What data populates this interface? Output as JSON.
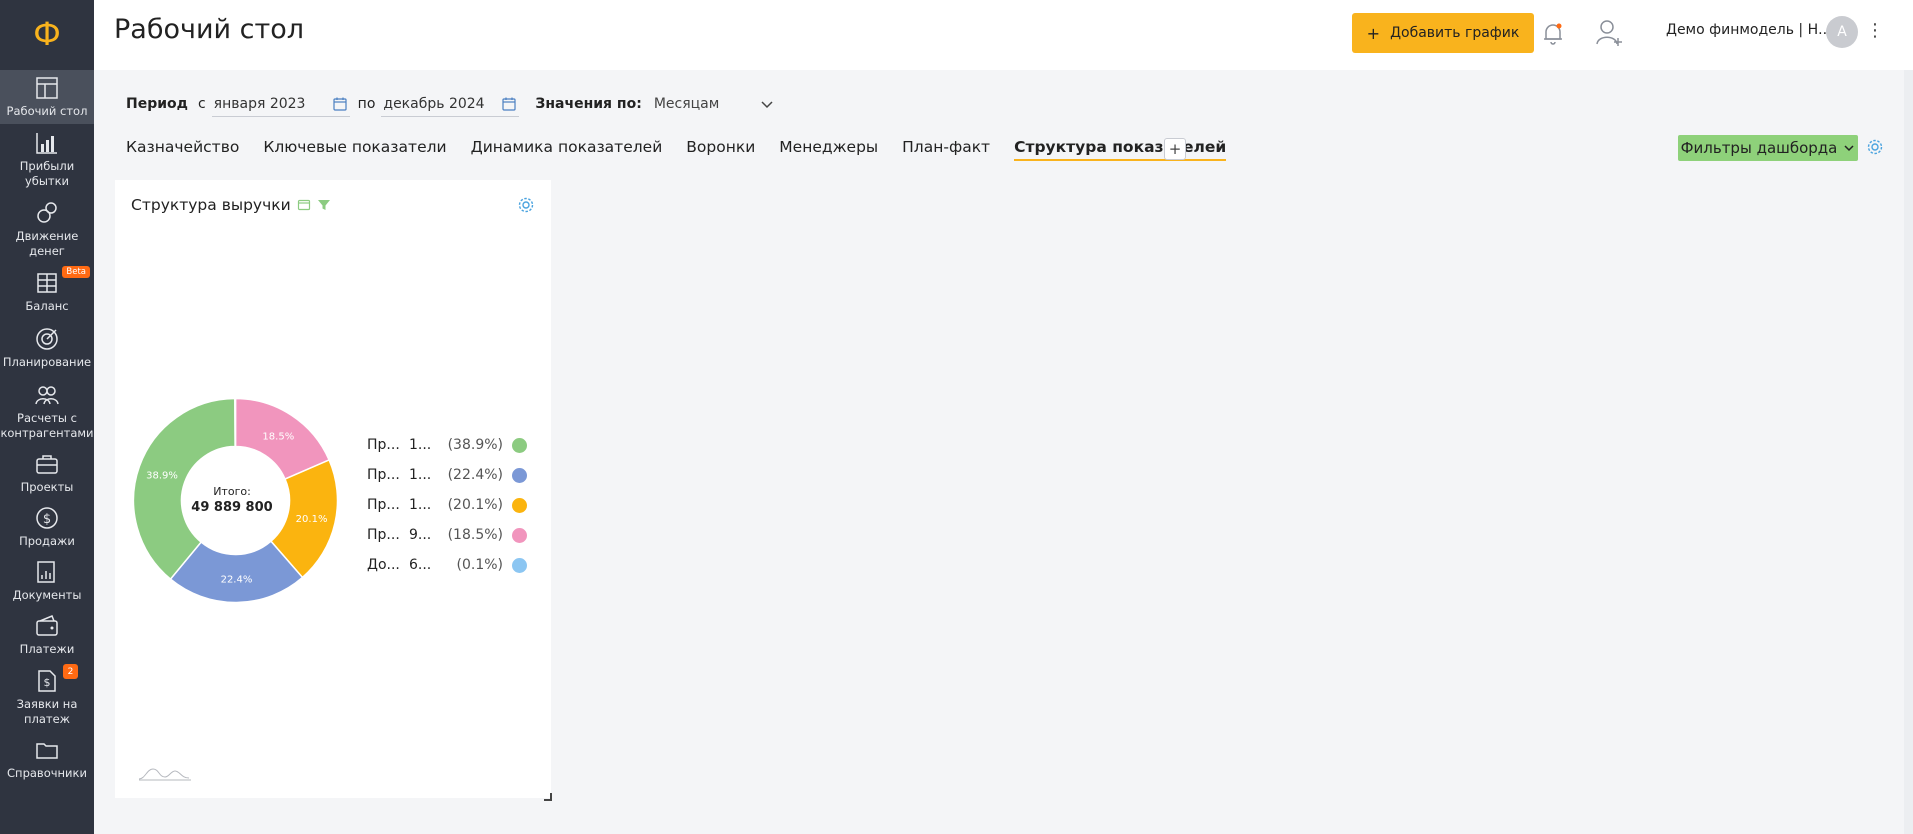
{
  "app": {
    "logo_letter": "Ф"
  },
  "sidebar": {
    "items": [
      {
        "label": "Рабочий стол",
        "icon": "dashboard-icon",
        "active": true
      },
      {
        "label": "Прибыли убытки",
        "icon": "bar-chart-icon"
      },
      {
        "label": "Движение денег",
        "icon": "money-flow-icon"
      },
      {
        "label": "Баланс",
        "icon": "balance-icon",
        "badge": "Beta"
      },
      {
        "label": "Планирование",
        "icon": "target-icon"
      },
      {
        "label": "Расчеты с контрагентами",
        "icon": "contractors-icon"
      },
      {
        "label": "Проекты",
        "icon": "briefcase-icon"
      },
      {
        "label": "Продажи",
        "icon": "dollar-icon"
      },
      {
        "label": "Документы",
        "icon": "documents-icon"
      },
      {
        "label": "Платежи",
        "icon": "wallet-icon"
      },
      {
        "label": "Заявки на платеж",
        "icon": "payment-request-icon",
        "badge": "2"
      },
      {
        "label": "Справочники",
        "icon": "folder-icon"
      }
    ]
  },
  "header": {
    "title": "Рабочий стол",
    "add_button": "Добавить график",
    "add_plus": "+",
    "account": "Демо финмодель | Н...",
    "avatar_letter": "А",
    "more": "⋮"
  },
  "period": {
    "label": "Период",
    "from_label": "с",
    "from_value": "января 2023",
    "to_label": "по",
    "to_value": "декабрь 2024",
    "values_label": "Значения по:",
    "values_value": "Месяцам"
  },
  "tabs": [
    {
      "label": "Казначейство"
    },
    {
      "label": "Ключевые показатели"
    },
    {
      "label": "Динамика показателей"
    },
    {
      "label": "Воронки"
    },
    {
      "label": "Менеджеры"
    },
    {
      "label": "План-факт"
    },
    {
      "label": "Структура показателей",
      "active": true
    }
  ],
  "tab_add": "+",
  "filters_button": "Фильтры дашборда",
  "card": {
    "title": "Структура выручки",
    "total_label": "Итого:",
    "total_value": "49 889 800",
    "legend": [
      {
        "name": "Пр...",
        "value": "1...",
        "pct": "(38.9%)",
        "color": "#8ccb81"
      },
      {
        "name": "Пр...",
        "value": "1...",
        "pct": "(22.4%)",
        "color": "#7b98d6"
      },
      {
        "name": "Пр...",
        "value": "1...",
        "pct": "(20.1%)",
        "color": "#fbb40f"
      },
      {
        "name": "Пр...",
        "value": "9...",
        "pct": "(18.5%)",
        "color": "#f195bd"
      },
      {
        "name": "До...",
        "value": "6...",
        "pct": "(0.1%)",
        "color": "#8cc6f2"
      }
    ]
  },
  "chart_data": {
    "type": "pie",
    "title": "Структура выручки",
    "total": 49889800,
    "slices": [
      {
        "value": 18.5,
        "label": "18.5%",
        "color": "#f195bd"
      },
      {
        "value": 20.1,
        "label": "20.1%",
        "color": "#fbb40f"
      },
      {
        "value": 22.4,
        "label": "22.4%",
        "color": "#7b98d6"
      },
      {
        "value": 38.9,
        "label": "38.9%",
        "color": "#8ccb81"
      },
      {
        "value": 0.1,
        "label": "",
        "color": "#8cc6f2"
      }
    ]
  }
}
